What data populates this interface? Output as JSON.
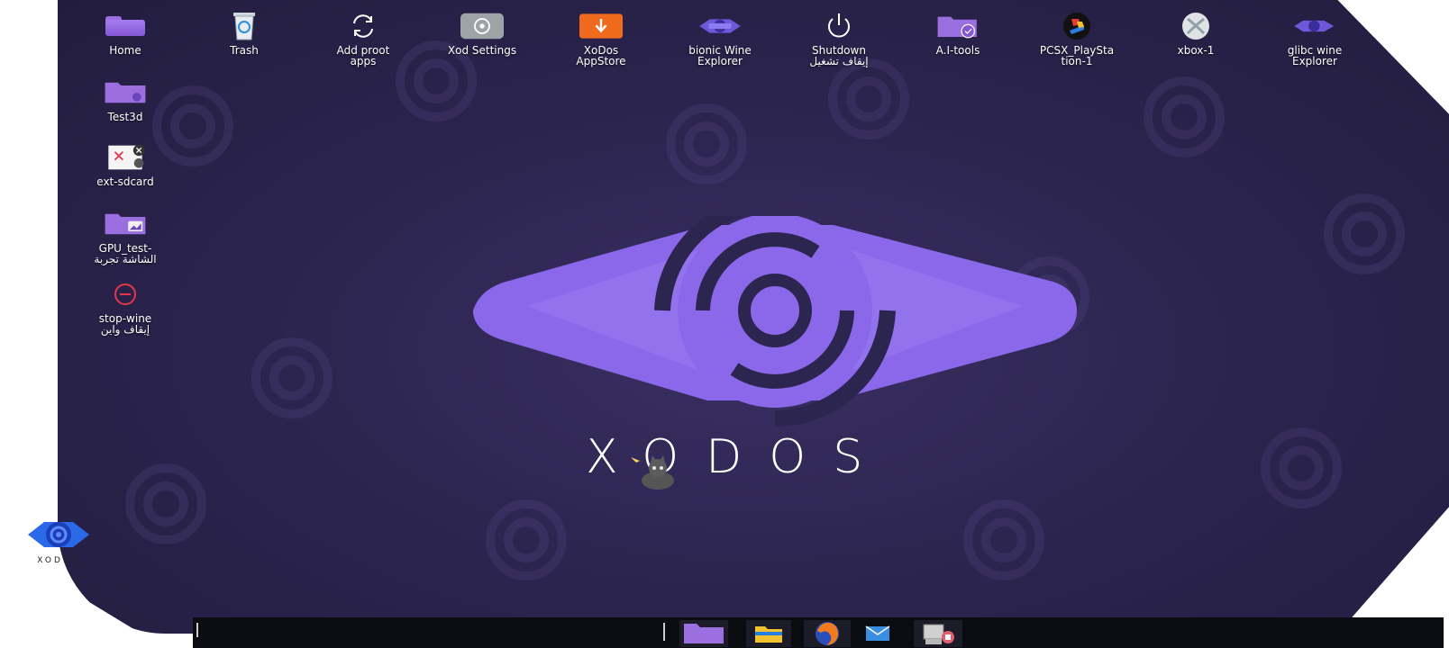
{
  "desktop": {
    "top_icons": [
      {
        "name": "icon-home",
        "label": "Home",
        "icon": "folder-icon"
      },
      {
        "name": "icon-trash",
        "label": "Trash",
        "icon": "trash-icon"
      },
      {
        "name": "icon-add-proot-apps",
        "label": "Add proot\napps",
        "icon": "refresh-icon"
      },
      {
        "name": "icon-xod-settings",
        "label": "Xod Settings",
        "icon": "gear-icon"
      },
      {
        "name": "icon-xodos-appstore",
        "label": "XoDos\nAppStore",
        "icon": "download-icon"
      },
      {
        "name": "icon-bionic-wine-explorer",
        "label": "bionic Wine\nExplorer",
        "icon": "bionic-badge-icon"
      },
      {
        "name": "icon-shutdown",
        "label": "Shutdown",
        "label2": "إيقاف تشغيل",
        "icon": "power-icon"
      },
      {
        "name": "icon-ai-tools",
        "label": "A.I-tools",
        "icon": "folder-check-icon"
      },
      {
        "name": "icon-pcsx-playstation",
        "label": "PCSX_PlaySta\ntion-1",
        "icon": "playstation-icon"
      },
      {
        "name": "icon-xbox",
        "label": "xbox-1",
        "icon": "xbox-icon"
      },
      {
        "name": "icon-glibc-wine-explorer",
        "label": "glibc wine\nExplorer",
        "icon": "glibc-badge-icon"
      }
    ],
    "left_icons": [
      {
        "name": "icon-test3d",
        "label": "Test3d",
        "icon": "folder-link-icon"
      },
      {
        "name": "icon-ext-sdcard",
        "label": "ext-sdcard",
        "icon": "broken-link-icon"
      },
      {
        "name": "icon-gpu-test",
        "label": "GPU_test-",
        "label2": "الشاشة تجربة",
        "icon": "folder-image-icon"
      },
      {
        "name": "icon-stop-wine",
        "label": "stop-wine",
        "label2": "إيقاف واين",
        "icon": "stop-icon"
      }
    ],
    "wallpaper_brand": "XODOS",
    "corner_brand": "XODOS"
  },
  "taskbar": {
    "items": [
      {
        "name": "taskbar-file-manager",
        "icon": "folder-icon"
      },
      {
        "name": "taskbar-explorer",
        "icon": "explorer-folder-icon"
      },
      {
        "name": "taskbar-firefox",
        "icon": "firefox-icon"
      },
      {
        "name": "taskbar-mail",
        "icon": "mail-icon"
      },
      {
        "name": "taskbar-system-tools",
        "icon": "computer-tools-icon"
      }
    ]
  },
  "colors": {
    "desktop_bg": "#2c2550",
    "logo_purple": "#8b68ea",
    "folder_purple": "#9b6fe0",
    "appstore_orange": "#f06a1e",
    "taskbar_bg": "#0b0b12"
  }
}
